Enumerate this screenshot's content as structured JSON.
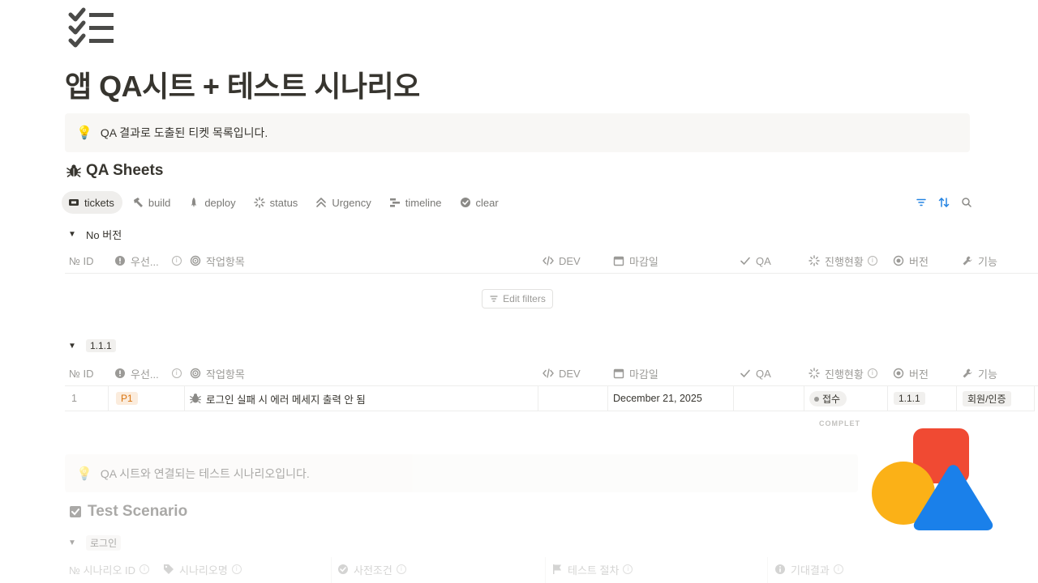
{
  "page": {
    "icon": "checklist-icon",
    "title": "앱 QA시트 + 테스트 시나리오",
    "callout": {
      "icon": "lightbulb-icon",
      "text": "QA 결과로 도출된 티켓 목록입니다."
    }
  },
  "qa_sheets": {
    "title": "QA Sheets",
    "icon": "bug-icon",
    "views": [
      {
        "label": "tickets",
        "icon": "ticket-icon",
        "active": true
      },
      {
        "label": "build",
        "icon": "hammer-icon"
      },
      {
        "label": "deploy",
        "icon": "rocket-icon"
      },
      {
        "label": "status",
        "icon": "loading-icon"
      },
      {
        "label": "Urgency",
        "icon": "chevrons-up-icon"
      },
      {
        "label": "timeline",
        "icon": "timeline-icon"
      },
      {
        "label": "clear",
        "icon": "check-badge-icon"
      }
    ],
    "toolbar": [
      "filter-icon",
      "sort-icon",
      "search-icon"
    ],
    "columns": {
      "id": "№ ID",
      "priority": "우선...",
      "task": "작업항목",
      "dev": "DEV",
      "deadline": "마감일",
      "qa": "QA",
      "progress": "진행현황",
      "version": "버전",
      "feature": "기능"
    },
    "groups": [
      {
        "name": "No 버전",
        "empty_action": "Edit filters"
      },
      {
        "name": "1.1.1"
      }
    ],
    "rows": [
      {
        "id": "1",
        "priority": "P1",
        "task": "로그인 실패 시 에러 메세지 출력 안 됨",
        "dev": "",
        "deadline": "December 21, 2025",
        "qa": "",
        "progress": "접수",
        "version": "1.1.1",
        "feature": "회원/인증"
      }
    ],
    "footer": "COMPLET"
  },
  "test_scenario": {
    "callout": {
      "icon": "lightbulb-icon",
      "text": "QA 시트와 연결되는 테스트 시나리오입니다."
    },
    "title": "Test Scenario",
    "icon": "checkbox-icon",
    "group": "로그인",
    "columns": {
      "scenario_id": "№ 시나리오 ID",
      "scenario_name": "시나리오명",
      "precondition": "사전조건",
      "procedure": "테스트 절차",
      "expected": "기대결과"
    }
  },
  "colors": {
    "priority_bg": "#fbecdd",
    "priority_fg": "#d9730d",
    "status_bg": "#f1f0ee",
    "logo_red": "#f04a33",
    "logo_yellow": "#fbb117",
    "logo_blue": "#1a80ea"
  }
}
